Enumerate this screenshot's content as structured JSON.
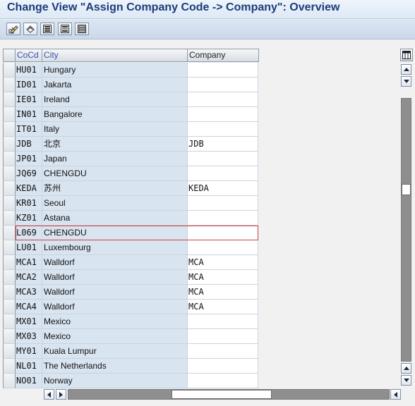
{
  "window": {
    "title": "Change View \"Assign Company Code -> Company\": Overview"
  },
  "toolbar": {
    "icons": [
      "display-change-icon",
      "other-entries-icon",
      "select-all-icon",
      "select-block-icon",
      "deselect-all-icon"
    ]
  },
  "table": {
    "columns": {
      "cocd": "CoCd",
      "city": "City",
      "company": "Company"
    },
    "rows": [
      {
        "cocd": "HU01",
        "city": "Hungary",
        "company": ""
      },
      {
        "cocd": "ID01",
        "city": "Jakarta",
        "company": ""
      },
      {
        "cocd": "IE01",
        "city": "Ireland",
        "company": ""
      },
      {
        "cocd": "IN01",
        "city": "Bangalore",
        "company": ""
      },
      {
        "cocd": "IT01",
        "city": "Italy",
        "company": ""
      },
      {
        "cocd": "JDB",
        "city": "北京",
        "company": "JDB"
      },
      {
        "cocd": "JP01",
        "city": "Japan",
        "company": ""
      },
      {
        "cocd": "JQ69",
        "city": "CHENGDU",
        "company": ""
      },
      {
        "cocd": "KEDA",
        "city": "苏州",
        "company": "KEDA"
      },
      {
        "cocd": "KR01",
        "city": "Seoul",
        "company": ""
      },
      {
        "cocd": "KZ01",
        "city": "Astana",
        "company": ""
      },
      {
        "cocd": "L069",
        "city": "CHENGDU",
        "company": ""
      },
      {
        "cocd": "LU01",
        "city": "Luxembourg",
        "company": ""
      },
      {
        "cocd": "MCA1",
        "city": "Walldorf",
        "company": "MCA"
      },
      {
        "cocd": "MCA2",
        "city": "Walldorf",
        "company": "MCA"
      },
      {
        "cocd": "MCA3",
        "city": "Walldorf",
        "company": "MCA"
      },
      {
        "cocd": "MCA4",
        "city": "Walldorf",
        "company": "MCA"
      },
      {
        "cocd": "MX01",
        "city": "Mexico",
        "company": ""
      },
      {
        "cocd": "MX03",
        "city": "Mexico",
        "company": ""
      },
      {
        "cocd": "MY01",
        "city": "Kuala Lumpur",
        "company": ""
      },
      {
        "cocd": "NL01",
        "city": "The Netherlands",
        "company": ""
      },
      {
        "cocd": "NO01",
        "city": "Norway",
        "company": ""
      }
    ],
    "highlighted_row": "L069"
  },
  "colors": {
    "title_text": "#1b3c7a",
    "key_column_bg": "#d9e4f1",
    "highlight_border": "#d33a3a"
  }
}
